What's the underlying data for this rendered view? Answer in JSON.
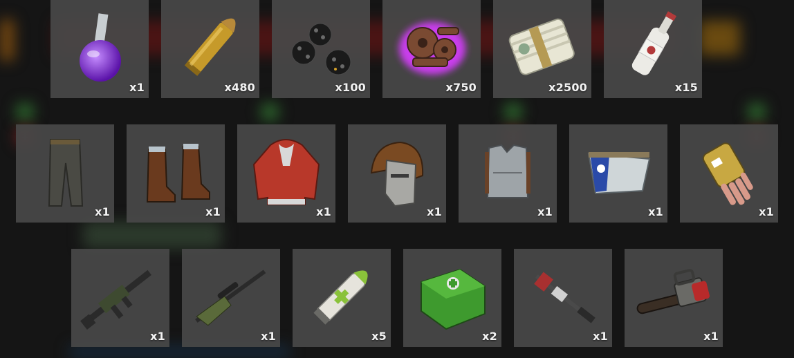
{
  "inventory": {
    "row1": [
      {
        "name": "chemistry-flask-icon",
        "qty": "x1"
      },
      {
        "name": "rifle-ammo-icon",
        "qty": "x480"
      },
      {
        "name": "berries-icon",
        "qty": "x100"
      },
      {
        "name": "gears-icon",
        "qty": "x750"
      },
      {
        "name": "money-bundle-icon",
        "qty": "x2500"
      },
      {
        "name": "bottle-icon",
        "qty": "x15"
      }
    ],
    "row2": [
      {
        "name": "pants-icon",
        "qty": "x1"
      },
      {
        "name": "boots-icon",
        "qty": "x1"
      },
      {
        "name": "hoodie-icon",
        "qty": "x1"
      },
      {
        "name": "helmet-icon",
        "qty": "x1"
      },
      {
        "name": "chestplate-icon",
        "qty": "x1"
      },
      {
        "name": "kilt-icon",
        "qty": "x1"
      },
      {
        "name": "gloves-icon",
        "qty": "x1"
      }
    ],
    "row3": [
      {
        "name": "assault-rifle-icon",
        "qty": "x1"
      },
      {
        "name": "sniper-rifle-icon",
        "qty": "x1"
      },
      {
        "name": "syringe-icon",
        "qty": "x5"
      },
      {
        "name": "medkit-icon",
        "qty": "x2"
      },
      {
        "name": "crossbow-icon",
        "qty": "x1"
      },
      {
        "name": "chainsaw-icon",
        "qty": "x1"
      }
    ]
  },
  "colors": {
    "slot_bg": "#484848",
    "qty_text": "#f2f2f2",
    "glow": "#d83cff"
  }
}
